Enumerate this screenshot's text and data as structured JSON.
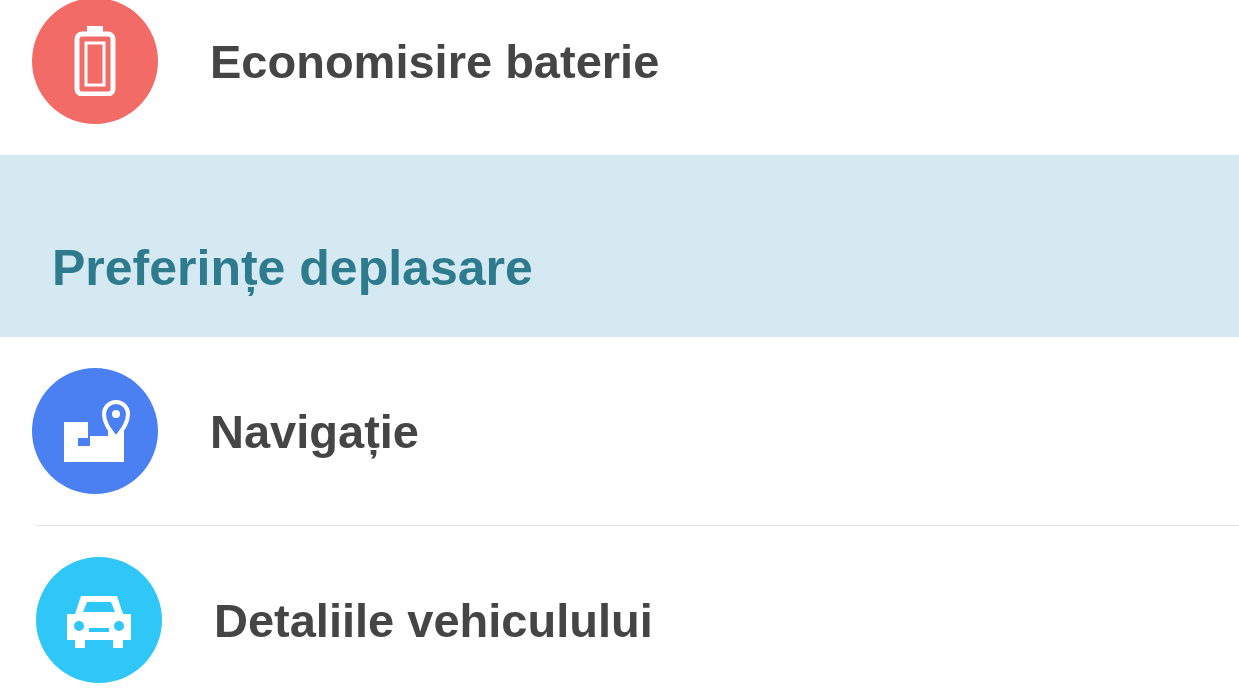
{
  "items": [
    {
      "kind": "row",
      "label": "Economisire baterie",
      "color": "#f26b66"
    },
    {
      "kind": "header",
      "label": "Preferințe deplasare"
    },
    {
      "kind": "row",
      "label": "Navigație",
      "color": "#4a80f2"
    },
    {
      "kind": "row",
      "label": "Detaliile vehiculului",
      "color": "#2ec7f7"
    }
  ]
}
